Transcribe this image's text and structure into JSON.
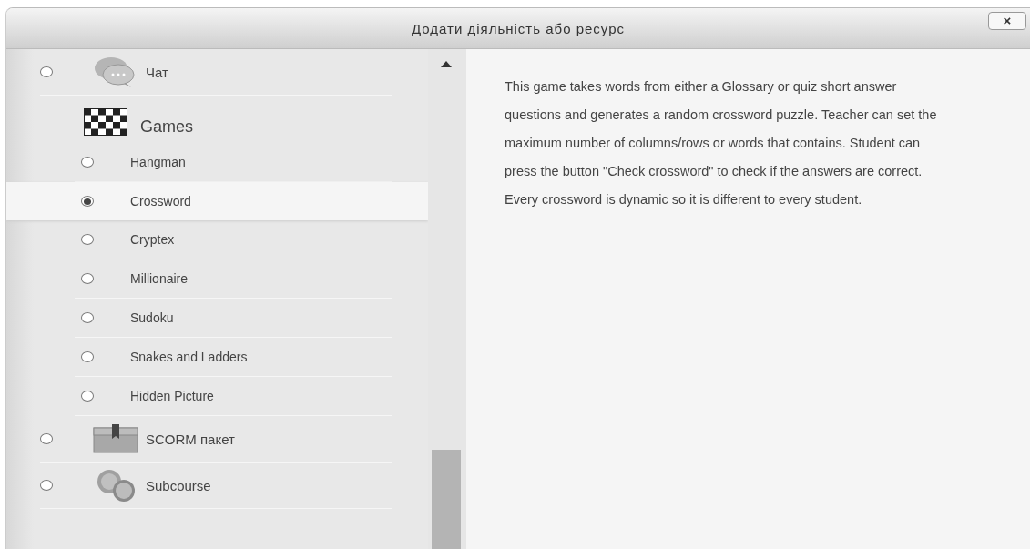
{
  "dialog": {
    "title": "Додати діяльність або ресурс",
    "close": "×"
  },
  "modules": [
    {
      "kind": "module",
      "label": "Чат",
      "selected": false
    },
    {
      "kind": "group",
      "label": "Games",
      "children": [
        {
          "label": "Hangman",
          "selected": false
        },
        {
          "label": "Crossword",
          "selected": true
        },
        {
          "label": "Cryptex",
          "selected": false
        },
        {
          "label": "Millionaire",
          "selected": false
        },
        {
          "label": "Sudoku",
          "selected": false
        },
        {
          "label": "Snakes and Ladders",
          "selected": false
        },
        {
          "label": "Hidden Picture",
          "selected": false
        }
      ]
    },
    {
      "kind": "module",
      "label": "SCORM пакет",
      "selected": false
    },
    {
      "kind": "module",
      "label": "Subcourse",
      "selected": false
    }
  ],
  "description": "This game takes words from either a Glossary or quiz short answer questions and generates a random crossword puzzle. Teacher can set the maximum number of columns/rows or words that contains. Student can press the button \"Check crossword\" to check if the answers are correct. Every crossword is dynamic so it is different to every student."
}
